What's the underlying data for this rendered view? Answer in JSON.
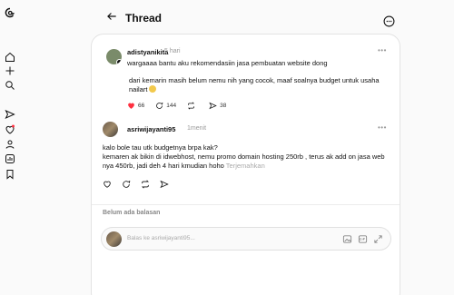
{
  "header": {
    "title": "Thread"
  },
  "post1": {
    "username": "adistyanikita",
    "time": "5 hari",
    "text": "wargaaaa bantu aku rekomendasiin jasa pembuatan website dong",
    "quote": "dari kemarin masih belum nemu nih yang cocok, maaf soalnya budget untuk usaha nailart",
    "likes": "66",
    "comments": "144",
    "shares": "38"
  },
  "post2": {
    "username": "asriwijayanti95",
    "time": "1menit",
    "text": "kalo bole tau utk budgetnya brpa kak?\nkemaren ak bikin di idwebhost, nemu promo domain hosting 250rb , terus ak add on jasa web nya 450rb, jadi deh 4 hari kmudian hoho",
    "translate": "Terjemahkan"
  },
  "replies": {
    "empty": "Belum ada balasan"
  },
  "reply_box": {
    "placeholder": "Balas ke asriwijayanti95..."
  },
  "colors": {
    "like": "#ff3040",
    "border": "#e3e3e3",
    "muted": "#999999"
  }
}
